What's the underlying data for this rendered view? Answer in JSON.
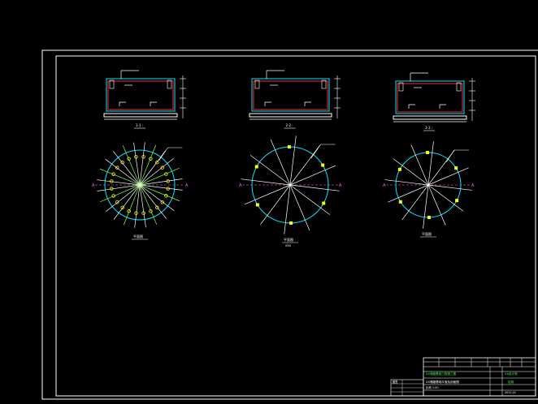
{
  "drawing": {
    "background": "#000000",
    "colors": {
      "frame": "#ffffff",
      "section_wall": "#00e5ff",
      "section_inner": "#ff2a2a",
      "footing": "#ffffff",
      "circle": "#00e5ff",
      "rays": "#ffffff",
      "bolt_green": "#7cff3c",
      "bolt_yellow": "#ffff00",
      "axis": "#ff66ff",
      "text": "#ffffff",
      "label_green": "#33ff33"
    },
    "sections": [
      {
        "id": "1-1",
        "label": "1-1 : ",
        "icon": "section-view-icon"
      },
      {
        "id": "2-2",
        "label": "2-2 : ",
        "icon": "section-view-icon"
      },
      {
        "id": "3-3",
        "label": "3-3 : ",
        "icon": "section-view-icon"
      }
    ],
    "plans": [
      {
        "label": "平面图",
        "sub": "",
        "bolt_count": 24,
        "ray_count": 24
      },
      {
        "label": "平面图",
        "sub": "XXX",
        "bolt_count": 6,
        "ray_count": 12
      },
      {
        "label": "平面图",
        "sub": "",
        "bolt_count": 6,
        "ray_count": 12
      }
    ],
    "axis_labels": {
      "left": "A",
      "right": "A"
    },
    "title_block": {
      "project": "XX储罐基础工程施工图",
      "drawing_title": "XX储罐基础平面及剖面图",
      "scale": "比例 1:50",
      "company": "XX设计院",
      "sheet": "结施",
      "date": "2012.01",
      "stamp_left": "图签"
    }
  }
}
